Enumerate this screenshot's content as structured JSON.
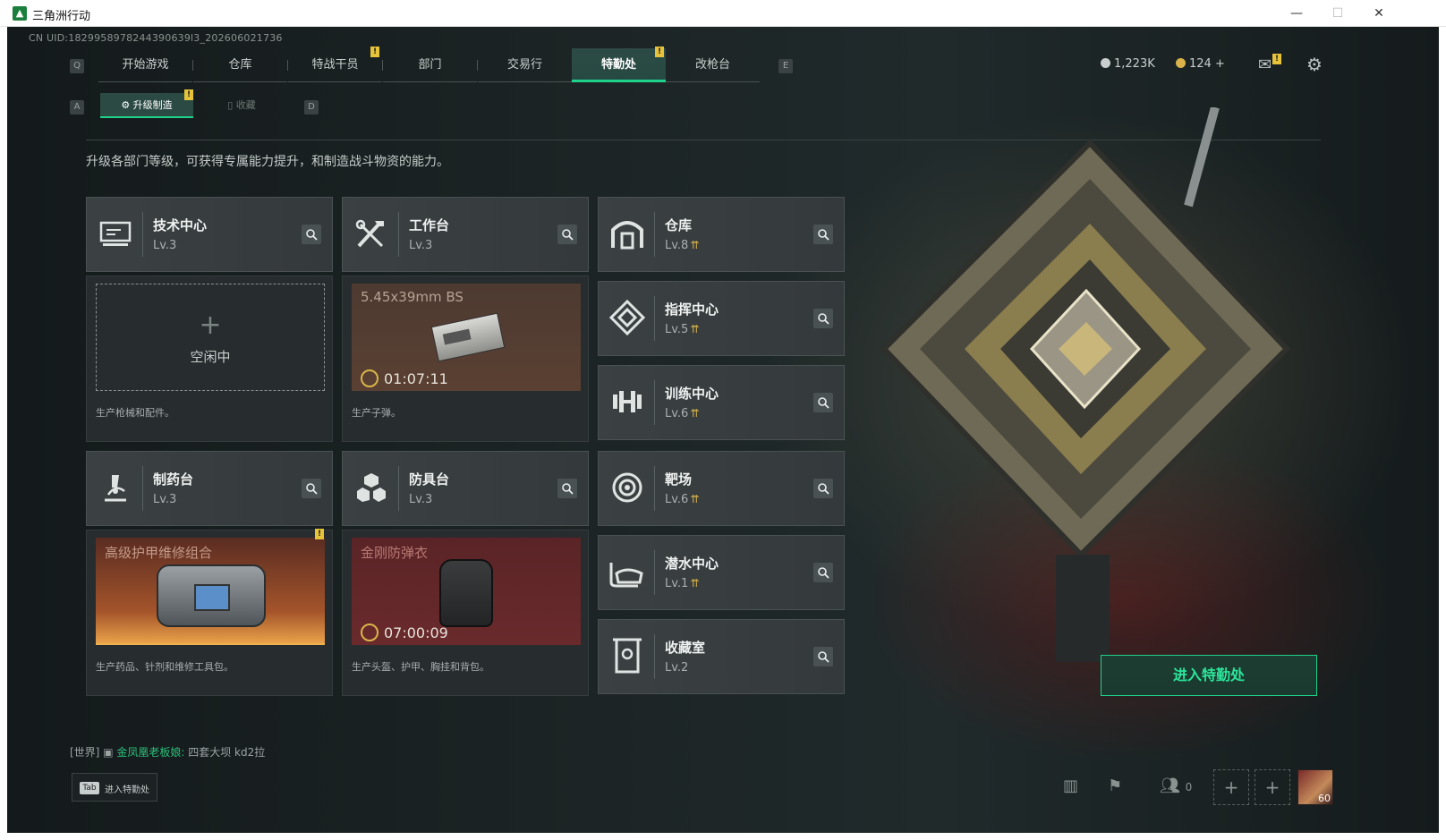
{
  "window": {
    "title": "三角洲行动",
    "controls": [
      "—",
      "☐",
      "✕"
    ]
  },
  "uid": "CN UID:1829958978244390639l3_202606021736",
  "nav": {
    "key_left": "Q",
    "key_right": "E",
    "tabs": [
      "开始游戏",
      "仓库",
      "特战干员",
      "部门",
      "交易行",
      "特勤处",
      "改枪台"
    ],
    "active": "特勤处",
    "badge": "!"
  },
  "currency": {
    "silver": "1,223K",
    "gold": "124",
    "plus": "+"
  },
  "subtabs": {
    "key_left": "A",
    "key_right": "D",
    "items": [
      "升级制造",
      "收藏"
    ],
    "active": "升级制造"
  },
  "description": "升级各部门等级，可获得专属能力提升，和制造战斗物资的能力。",
  "cards": [
    {
      "name": "技术中心",
      "level": "Lv.3",
      "upgrade": false,
      "icon": "monitor-icon"
    },
    {
      "name": "工作台",
      "level": "Lv.3",
      "upgrade": false,
      "icon": "tools-icon"
    },
    {
      "name": "仓库",
      "level": "Lv.8",
      "upgrade": true,
      "icon": "warehouse-icon"
    },
    {
      "name": "指挥中心",
      "level": "Lv.5",
      "upgrade": true,
      "icon": "chip-icon"
    },
    {
      "name": "训练中心",
      "level": "Lv.6",
      "upgrade": true,
      "icon": "dumbbell-icon"
    },
    {
      "name": "制药台",
      "level": "Lv.3",
      "upgrade": false,
      "icon": "microscope-icon"
    },
    {
      "name": "防具台",
      "level": "Lv.3",
      "upgrade": false,
      "icon": "armor-parts-icon"
    },
    {
      "name": "靶场",
      "level": "Lv.6",
      "upgrade": true,
      "icon": "target-icon"
    },
    {
      "name": "潜水中心",
      "level": "Lv.1",
      "upgrade": true,
      "icon": "diving-mask-icon"
    },
    {
      "name": "收藏室",
      "level": "Lv.2",
      "upgrade": false,
      "icon": "cabinet-icon"
    }
  ],
  "panels": {
    "tech": {
      "empty_plus": "+",
      "empty_label": "空闲中",
      "note": "生产枪械和配件。"
    },
    "workbench": {
      "item": "5.45x39mm BS",
      "timer": "01:07:11",
      "note": "生产子弹。"
    },
    "pharmacy": {
      "item": "高级护甲维修组合",
      "note": "生产药品、针剂和维修工具包。"
    },
    "armor": {
      "item": "金刚防弹衣",
      "timer": "07:00:09",
      "note": "生产头盔、护甲、胸挂和背包。"
    }
  },
  "enter_button": "进入特勤处",
  "chat": {
    "channel": "[世界]",
    "sender": "金凤凰老板娘:",
    "message": "四套大坝 kd2拉"
  },
  "tab_hint": {
    "key": "Tab",
    "text": "进入特勤处"
  },
  "bottom": {
    "friends_count": "0",
    "avatar_level": "60"
  },
  "colors": {
    "accent": "#1fd18a",
    "badge": "#e7c33a",
    "upgrade": "#d9b34a"
  }
}
